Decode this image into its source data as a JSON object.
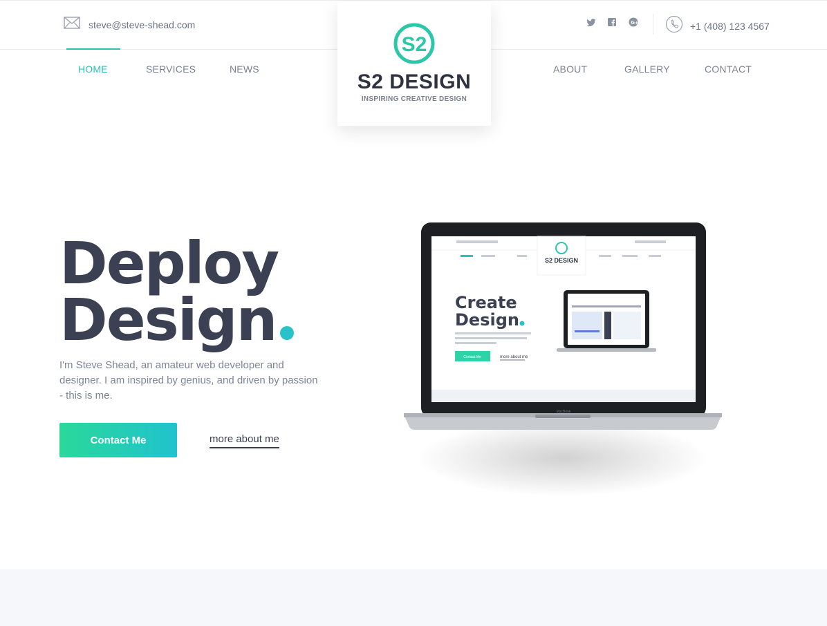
{
  "contact": {
    "email": "steve@steve-shead.com",
    "phone": "+1 (408) 123 4567",
    "email_icon": "envelope-icon",
    "phone_icon": "phone-icon"
  },
  "social": [
    "twitter-icon",
    "facebook-icon",
    "google-plus-icon"
  ],
  "logo": {
    "mark": "S2",
    "name": "S2 DESIGN",
    "tagline": "INSPIRING CREATIVE DESIGN"
  },
  "nav": {
    "left": [
      "HOME",
      "SERVICES",
      "NEWS"
    ],
    "right": [
      "ABOUT",
      "GALLERY",
      "CONTACT"
    ],
    "active": "HOME"
  },
  "hero": {
    "title_line1": "Deploy",
    "title_line2": "Design",
    "description": "I'm Steve Shead, an amateur web developer and designer. I am inspired by genius, and driven by passion - this is me.",
    "primary_button": "Contact Me",
    "secondary_link": "more about me"
  },
  "laptop_screen": {
    "title_line1": "Create",
    "title_line2": "Design",
    "button": "Contact Me",
    "link": "more about me",
    "brand": "MacBook"
  },
  "colors": {
    "accent": "#2ac2b8",
    "heading": "#3b4052",
    "body_text": "#7d8499",
    "button_gradient_start": "#2bd89a",
    "button_gradient_end": "#1fc3cd"
  }
}
